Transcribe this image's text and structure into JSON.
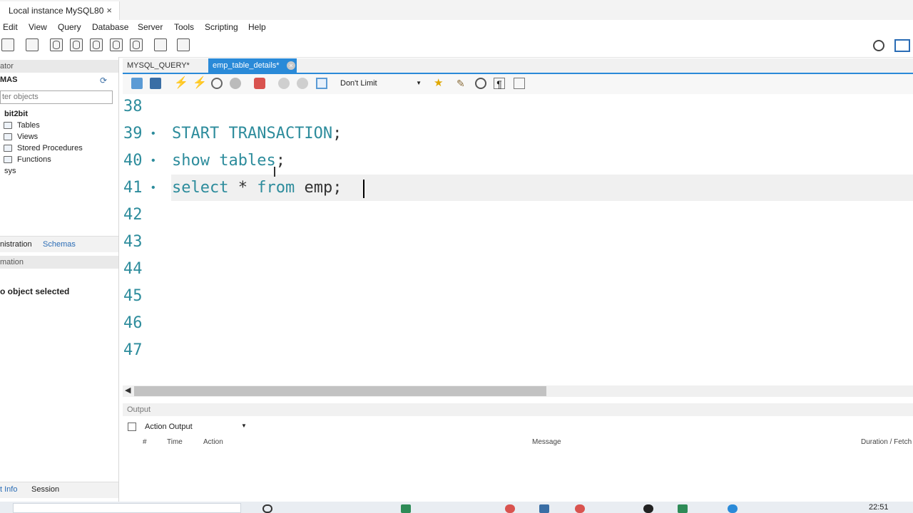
{
  "window": {
    "tab_title": "Local instance MySQL80",
    "close_glyph": "×"
  },
  "menu": {
    "items": [
      "Edit",
      "View",
      "Query",
      "Database",
      "Server",
      "Tools",
      "Scripting",
      "Help"
    ]
  },
  "sidebar": {
    "navigator_header": "ator",
    "schemas_header": "MAS",
    "filter_placeholder": "ter objects",
    "schema_name": "bit2bit",
    "tree_items": [
      "Tables",
      "Views",
      "Stored Procedures",
      "Functions"
    ],
    "other_schema": "sys",
    "admin_tabs": [
      "nistration",
      "Schemas"
    ],
    "info_header": "mation",
    "no_object": "o object selected",
    "bottom_tabs": [
      "t Info",
      "Session"
    ]
  },
  "editor": {
    "tabs": [
      {
        "label": "MYSQL_QUERY*"
      },
      {
        "label": "emp_table_details*"
      }
    ],
    "limit": "Don't Limit",
    "lines": [
      {
        "n": "38",
        "bullet": ""
      },
      {
        "n": "39",
        "bullet": "•"
      },
      {
        "n": "40",
        "bullet": "•"
      },
      {
        "n": "41",
        "bullet": "•"
      },
      {
        "n": "42",
        "bullet": ""
      },
      {
        "n": "43",
        "bullet": ""
      },
      {
        "n": "44",
        "bullet": ""
      },
      {
        "n": "45",
        "bullet": ""
      },
      {
        "n": "46",
        "bullet": ""
      },
      {
        "n": "47",
        "bullet": ""
      }
    ],
    "code": {
      "l39_kw": "START TRANSACTION",
      "l39_end": ";",
      "l40_kw1": "show",
      "l40_kw2": "tables",
      "l40_end": ";",
      "l41_kw1": "select",
      "l41_mid": " * ",
      "l41_kw2": "from",
      "l41_end": " emp;"
    }
  },
  "output": {
    "header": "Output",
    "selector": "Action Output",
    "columns": [
      "#",
      "Time",
      "Action",
      "Message",
      "Duration / Fetch"
    ]
  },
  "taskbar": {
    "time": "22:51"
  },
  "colors": {
    "accent": "#2a8ad8",
    "keyword": "#2d8c9c"
  }
}
